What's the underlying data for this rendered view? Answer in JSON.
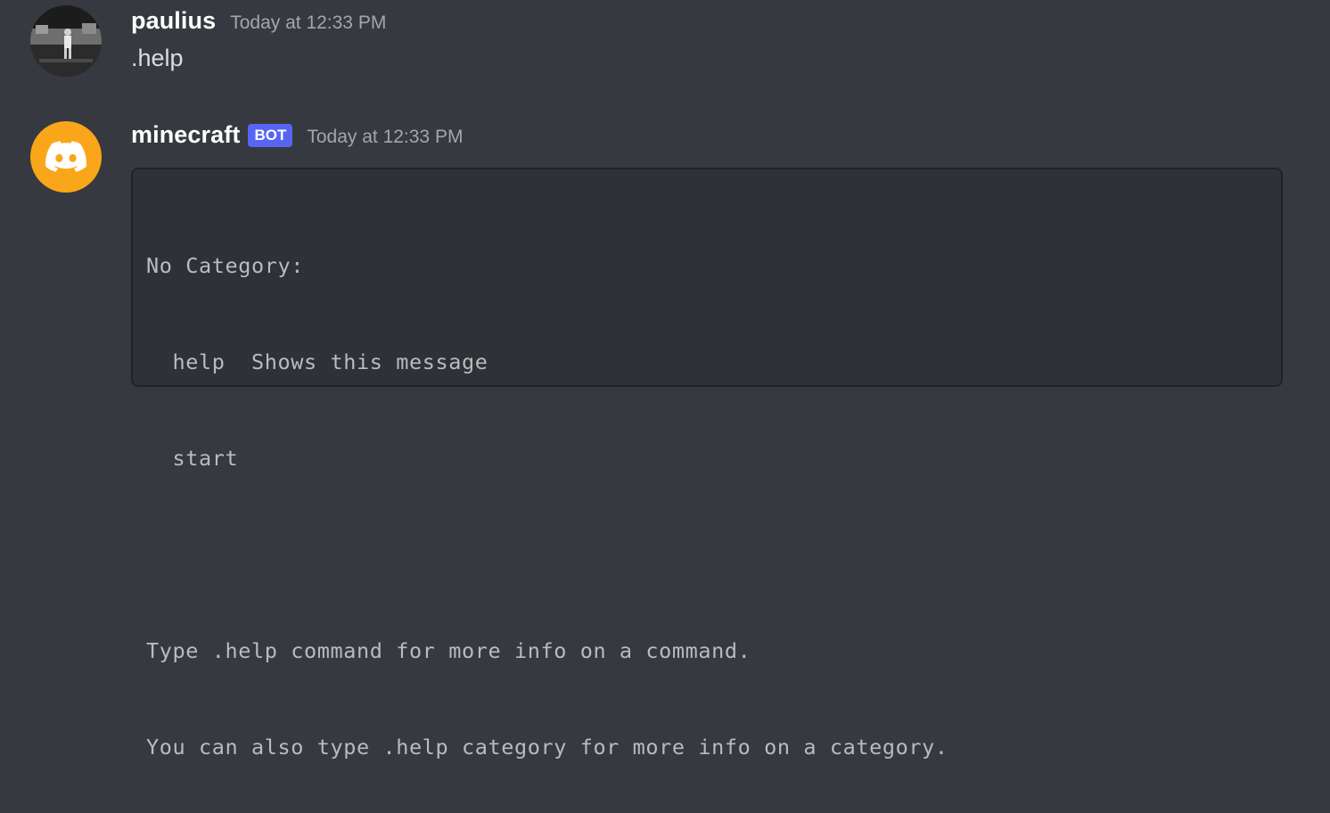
{
  "messages": [
    {
      "author": "paulius",
      "timestamp": "Today at 12:33 PM",
      "content": ".help",
      "avatar_icon": "user-photo-avatar"
    },
    {
      "author": "minecraft",
      "bot_tag": "BOT",
      "timestamp": "Today at 12:33 PM",
      "avatar_icon": "discord-logo-icon",
      "code_lines": [
        "No Category:",
        "  help  Shows this message",
        "  start",
        "",
        "Type .help command for more info on a command.",
        "You can also type .help category for more info on a category."
      ]
    }
  ],
  "colors": {
    "background": "#36393f",
    "bot_avatar": "#faa61a",
    "bot_tag": "#5865f2",
    "codeblock_bg": "#2f3136"
  }
}
